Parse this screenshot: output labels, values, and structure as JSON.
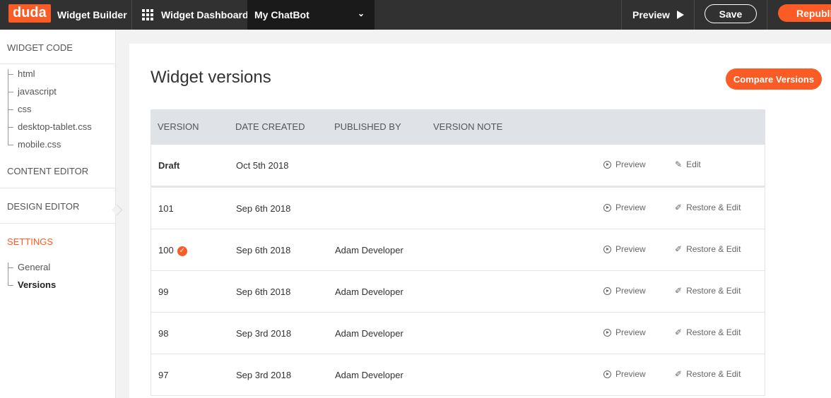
{
  "topbar": {
    "logo": "duda",
    "app_name": "Widget Builder",
    "dashboard": "Widget Dashboard",
    "widget_selector": "My ChatBot",
    "preview": "Preview",
    "save": "Save",
    "republish": "Republish"
  },
  "sidebar": {
    "widget_code": "WIDGET CODE",
    "code_files": [
      "html",
      "javascript",
      "css",
      "desktop-tablet.css",
      "mobile.css"
    ],
    "content_editor": "CONTENT EDITOR",
    "design_editor": "DESIGN EDITOR",
    "settings": "SETTINGS",
    "settings_items": [
      "General",
      "Versions"
    ]
  },
  "main": {
    "title": "Widget versions",
    "compare_button": "Compare Versions",
    "columns": [
      "VERSION",
      "DATE CREATED",
      "PUBLISHED BY",
      "VERSION NOTE"
    ],
    "rows": [
      {
        "version": "Draft",
        "date": "Oct 5th 2018",
        "publisher": "",
        "preview": "Preview",
        "action": "Edit"
      },
      {
        "version": "101",
        "date": "Sep 6th 2018",
        "publisher": "",
        "preview": "Preview",
        "action": "Restore & Edit"
      },
      {
        "version": "100",
        "date": "Sep 6th 2018",
        "publisher": "Adam Developer",
        "preview": "Preview",
        "action": "Restore & Edit"
      },
      {
        "version": "99",
        "date": "Sep 6th 2018",
        "publisher": "Adam Developer",
        "preview": "Preview",
        "action": "Restore & Edit"
      },
      {
        "version": "98",
        "date": "Sep 3rd 2018",
        "publisher": "Adam Developer",
        "preview": "Preview",
        "action": "Restore & Edit"
      },
      {
        "version": "97",
        "date": "Sep 3rd 2018",
        "publisher": "Adam Developer",
        "preview": "Preview",
        "action": "Restore & Edit"
      }
    ]
  },
  "colors": {
    "accent": "#fb5b24",
    "topbar": "#313131",
    "table_header": "#dfe3e7"
  }
}
